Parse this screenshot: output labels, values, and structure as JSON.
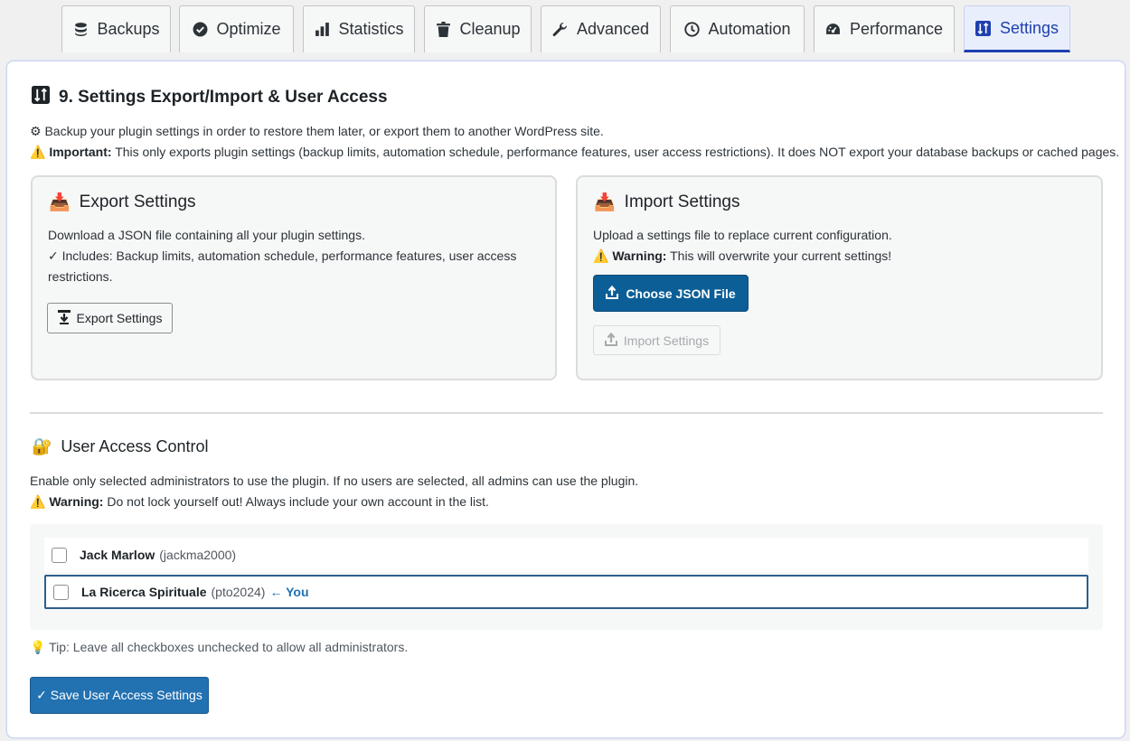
{
  "tabs": [
    {
      "label": "Backups",
      "icon": "database-icon"
    },
    {
      "label": "Optimize",
      "icon": "check-circle-icon"
    },
    {
      "label": "Statistics",
      "icon": "bar-chart-icon"
    },
    {
      "label": "Cleanup",
      "icon": "trash-icon"
    },
    {
      "label": "Advanced",
      "icon": "wrench-icon"
    },
    {
      "label": "Automation",
      "icon": "clock-icon"
    },
    {
      "label": "Performance",
      "icon": "gauge-icon"
    },
    {
      "label": "Settings",
      "icon": "sort-icon",
      "active": true
    }
  ],
  "section": {
    "title": "9. Settings Export/Import & User Access",
    "intro": "⚙ Backup your plugin settings in order to restore them later, or export them to another WordPress site.",
    "important_label": "Important:",
    "important_text": "This only exports plugin settings (backup limits, automation schedule, performance features, user access restrictions). It does NOT export your database backups or cached pages."
  },
  "export_card": {
    "title": "Export Settings",
    "desc": "Download a JSON file containing all your plugin settings.",
    "includes_line1": "✓ Includes: Backup limits, automation schedule, performance features, user access",
    "includes_line2": "restrictions.",
    "button": "Export Settings"
  },
  "import_card": {
    "title": "Import Settings",
    "desc": "Upload a settings file to replace current configuration.",
    "warning_label": "Warning:",
    "warning_text": "This will overwrite your current settings!",
    "choose_button": "Choose JSON File",
    "import_button": "Import Settings"
  },
  "access": {
    "title": "User Access Control",
    "desc": "Enable only selected administrators to use the plugin. If no users are selected, all admins can use the plugin.",
    "warning_label": "Warning:",
    "warning_text": "Do not lock yourself out! Always include your own account in the list.",
    "users": [
      {
        "name": "Jack Marlow",
        "handle": "(jackma2000)",
        "checked": false
      },
      {
        "name": "La Ricerca Spirituale",
        "handle": "(pto2024)",
        "you": "← You",
        "checked": false
      }
    ],
    "tip": "Tip: Leave all checkboxes unchecked to allow all administrators.",
    "save_button": "✓ Save User Access Settings"
  },
  "colors": {
    "accent": "#1e40af",
    "primary": "#2271b1",
    "warning": "#f0b849"
  }
}
